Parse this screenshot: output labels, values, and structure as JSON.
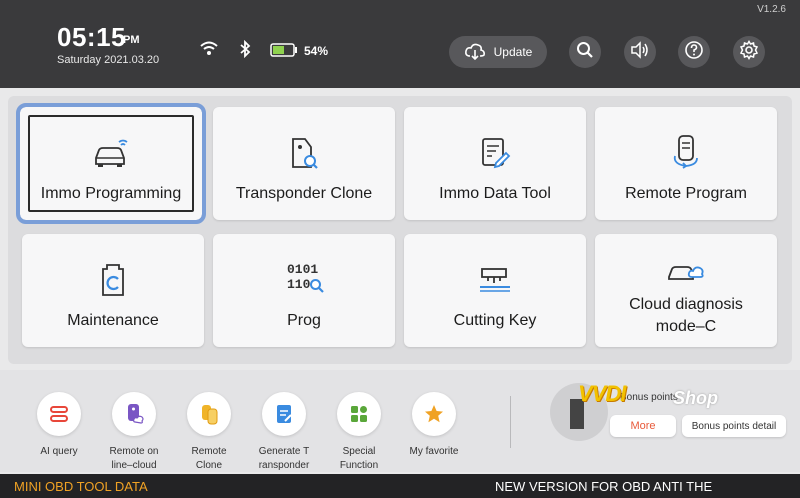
{
  "header": {
    "version": "V1.2.6",
    "time": "05:15",
    "ampm": "PM",
    "date": "Saturday 2021.03.20",
    "battery": "54%",
    "update_label": "Update",
    "icons": [
      "wifi-icon",
      "bluetooth-icon",
      "battery-icon",
      "cloud-download-icon",
      "search-icon",
      "volume-icon",
      "help-icon",
      "settings-icon"
    ]
  },
  "tiles": [
    {
      "label": "Immo Programming",
      "icon": "car-key-icon"
    },
    {
      "label": "Transponder Clone",
      "icon": "transponder-icon"
    },
    {
      "label": "Immo Data Tool",
      "icon": "document-edit-icon"
    },
    {
      "label": "Remote Program",
      "icon": "remote-icon"
    },
    {
      "label": "Maintenance",
      "icon": "maintenance-icon"
    },
    {
      "label": "Prog",
      "icon_text_1": "0101",
      "icon_text_2": "1101",
      "icon": "binary-icon"
    },
    {
      "label": "Cutting Key",
      "icon": "key-cutting-icon"
    },
    {
      "label_line1": "Cloud diagnosis",
      "label_line2": "mode–C",
      "icon": "cloud-car-icon"
    }
  ],
  "shortcuts": [
    {
      "line1": "AI query",
      "line2": ""
    },
    {
      "line1": "Remote on",
      "line2": "line–cloud"
    },
    {
      "line1": "Remote",
      "line2": "Clone"
    },
    {
      "line1": "Generate T",
      "line2": "ransponder"
    },
    {
      "line1": "Special",
      "line2": "Function"
    },
    {
      "line1": "My favorite",
      "line2": ""
    }
  ],
  "user": {
    "brand": "VVDI",
    "brand_suffix": "Shop",
    "bonus_text": "Bonus points",
    "more": "More",
    "bonus_detail": "Bonus points detail"
  },
  "footer": {
    "left": "MINI OBD TOOL DATA",
    "right": "NEW VERSION FOR OBD ANTI THE"
  },
  "colors": {
    "header": "#3a3a3c",
    "accent_orange": "#f0a224",
    "more_red": "#e85a3a",
    "selection": "#7a9ed8"
  }
}
